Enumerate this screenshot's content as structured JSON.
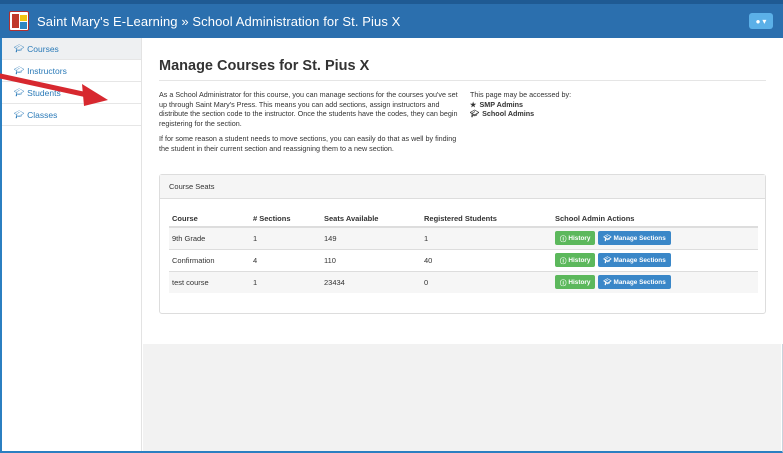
{
  "navbar": {
    "title": "Saint Mary's E-Learning » School Administration for St. Pius X",
    "user_icon": "user-icon",
    "accent": "#2b6fae"
  },
  "sidebar": {
    "items": [
      {
        "label": "Courses",
        "icon": "graduation-cap-icon"
      },
      {
        "label": "Instructors",
        "icon": "graduation-cap-icon"
      },
      {
        "label": "Students",
        "icon": "graduation-cap-icon"
      },
      {
        "label": "Classes",
        "icon": "graduation-cap-icon"
      }
    ]
  },
  "main": {
    "title": "Manage Courses for St. Pius X",
    "intro_p1": "As a School Administrator for this course, you can manage sections for the courses you've set up through Saint Mary's Press. This means you can add sections, assign instructors and distribute the section code to the instructor. Once the students have the codes, they can begin registering for the section.",
    "intro_p2": "If for some reason a student needs to move sections, you can easily do that as well by finding the student in their current section and reassigning them to a new section.",
    "access": {
      "heading": "This page may be accessed by:",
      "items": [
        {
          "label": "SMP Admins",
          "icon": "star-icon"
        },
        {
          "label": "School Admins",
          "icon": "graduation-cap-icon"
        }
      ]
    }
  },
  "panel": {
    "heading": "Course Seats",
    "columns": [
      "Course",
      "# Sections",
      "Seats Available",
      "Registered Students",
      "School Admin Actions"
    ],
    "rows": [
      {
        "course": "9th Grade",
        "sections": "1",
        "seats": "149",
        "registered": "1"
      },
      {
        "course": "Confirmation",
        "sections": "4",
        "seats": "110",
        "registered": "40"
      },
      {
        "course": "test course",
        "sections": "1",
        "seats": "23434",
        "registered": "0"
      }
    ],
    "history_label": "History",
    "manage_label": "Manage Sections"
  },
  "colors": {
    "history": "#5cb85c",
    "manage": "#3a87c8",
    "annotation_arrow": "#d7282f"
  }
}
